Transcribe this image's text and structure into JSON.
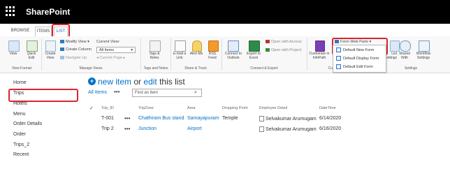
{
  "suite": {
    "brand": "SharePoint"
  },
  "tabs": [
    "BROWSE",
    "ITEMS",
    "LIST"
  ],
  "ribbon": {
    "view_format": {
      "view": "View",
      "quick_edit": "Quick Edit",
      "group": "View Format"
    },
    "manage_views": {
      "create_view": "Create View",
      "modify_view": "Modify View",
      "create_column": "Create Column",
      "navigate_up": "Navigate Up",
      "current_view_label": "Current View:",
      "current_view_value": "All Items",
      "current_page": "Current Page",
      "group": "Manage Views"
    },
    "tags_notes": {
      "tags_notes": "Tags & Notes",
      "group": "Tags and Notes"
    },
    "share_track": {
      "email_link": "E-mail a Link",
      "alert_me": "Alert Me",
      "rss_feed": "RSS Feed",
      "group": "Share & Track"
    },
    "connect_export": {
      "connect_outlook": "Connect to Outlook",
      "export_excel": "Export to Excel",
      "open_access": "Open with Access",
      "open_project": "Open with Project",
      "group": "Connect & Export"
    },
    "customize": {
      "customize_infopath": "Customize in InfoPath",
      "group_partial": "Cu",
      "form_web_parts": "Form Web Parts"
    },
    "settings": {
      "list_settings": "List Settings",
      "shared_with": "Shared With",
      "workflow_settings": "Workflow Settings",
      "group": "Settings"
    },
    "dropdown": [
      "Default New Form",
      "Default Display Form",
      "Default Edit Form"
    ]
  },
  "leftnav": [
    "Home",
    "Trips",
    "Hotels",
    "Menu",
    "Order Details",
    "Order",
    "Trips_2",
    "Recent"
  ],
  "main": {
    "new_item": "new item",
    "or": "or",
    "edit": "edit",
    "this_list": "this list",
    "all_items": "All Items",
    "ellipsis": "•••",
    "find_placeholder": "Find an item",
    "headers": [
      "Trip_ID",
      "TripZone",
      "Area",
      "Dropping Point",
      "Employee Detail",
      "DateTime"
    ],
    "rows": [
      {
        "id": "T-001",
        "zone": "Chathiram Bus stand",
        "area": "Samayapuram",
        "drop": "Temple",
        "employee": "Selvakumar Arumugam",
        "date": "6/14/2020"
      },
      {
        "id": "Trip 2",
        "zone": "Junction",
        "area": "Airport",
        "drop": "",
        "employee": "Selvakumar Arumugam",
        "date": "6/16/2020"
      }
    ]
  },
  "colors": {
    "accent": "#0072c6",
    "highlight": "#d9262e",
    "suitebar": "#000000"
  }
}
